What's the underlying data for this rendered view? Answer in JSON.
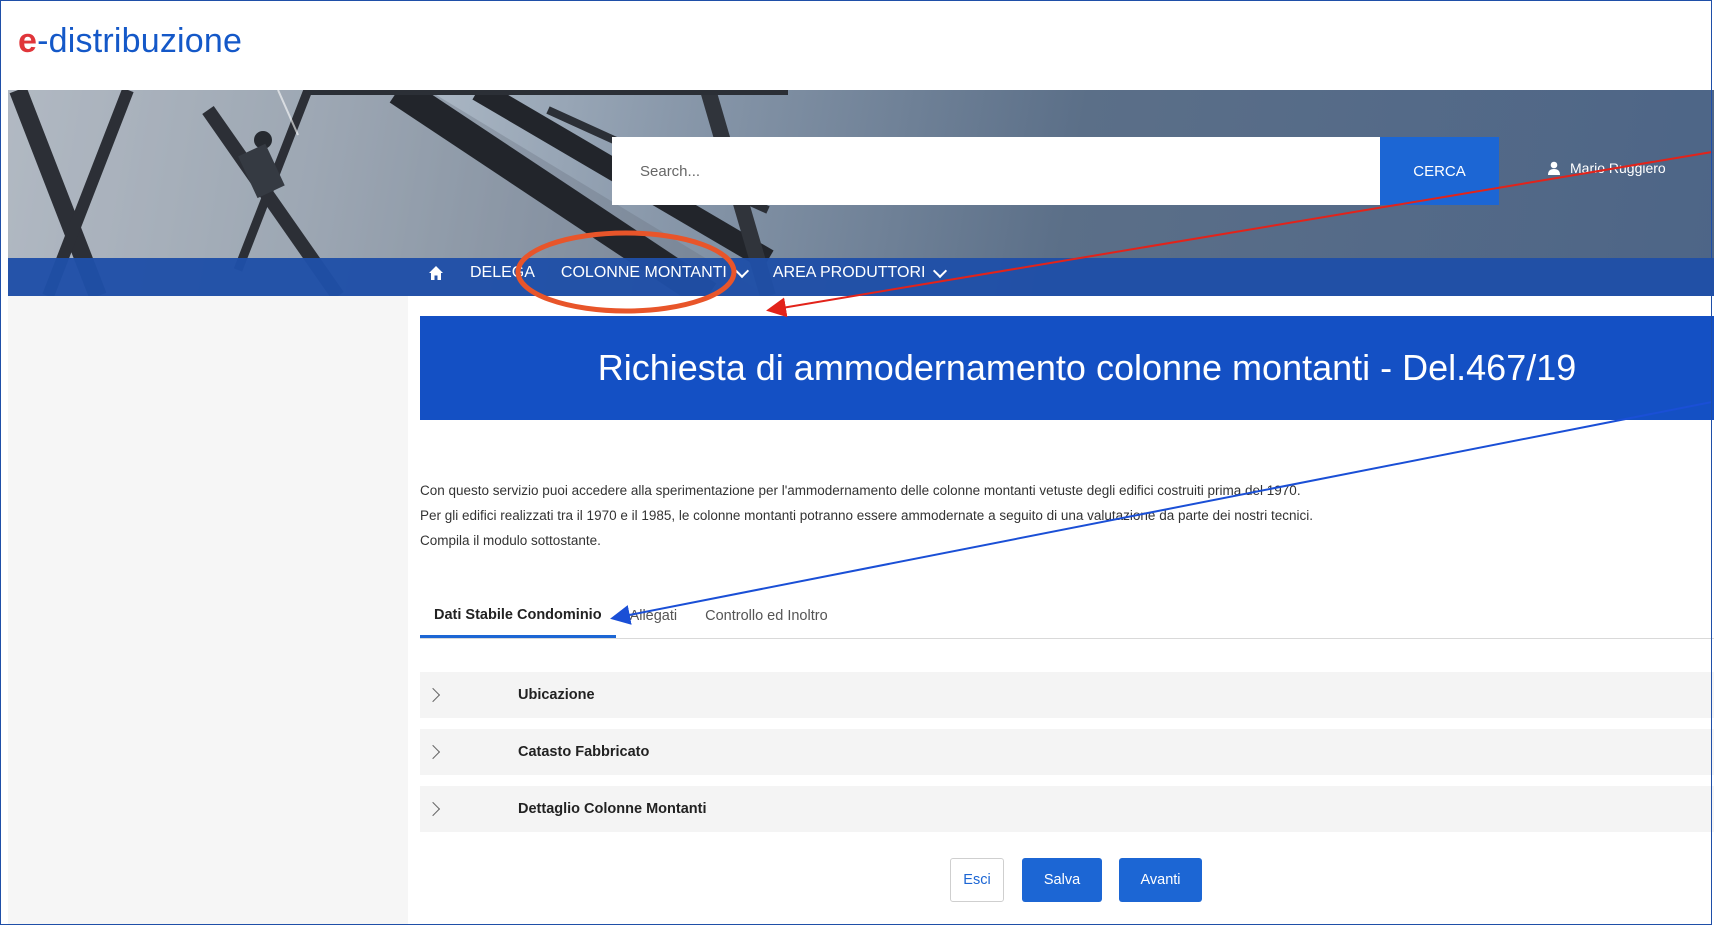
{
  "logo": {
    "prefix": "e",
    "text": "-distribuzione"
  },
  "search": {
    "placeholder": "Search...",
    "button_label": "CERCA"
  },
  "user": {
    "name": "Mario Ruggiero"
  },
  "nav": {
    "items": [
      {
        "label": "DELEGA"
      },
      {
        "label": "COLONNE MONTANTI"
      },
      {
        "label": "AREA PRODUTTORI"
      }
    ]
  },
  "page": {
    "title": "Richiesta di ammodernamento colonne montanti - Del.467/19",
    "description": [
      "Con questo servizio puoi accedere alla sperimentazione per l'ammodernamento delle colonne montanti vetuste degli edifici costruiti prima del 1970.",
      "Per gli edifici realizzati tra il 1970 e il 1985, le colonne montanti potranno essere ammodernate a seguito di una valutazione da parte dei nostri tecnici.",
      "Compila il modulo sottostante."
    ]
  },
  "tabs": [
    {
      "label": "Dati Stabile Condominio",
      "active": true
    },
    {
      "label": "Allegati",
      "active": false
    },
    {
      "label": "Controllo ed Inoltro",
      "active": false
    }
  ],
  "sections": [
    {
      "label": "Ubicazione"
    },
    {
      "label": "Catasto Fabbricato"
    },
    {
      "label": "Dettaglio Colonne Montanti"
    }
  ],
  "buttons": {
    "exit": "Esci",
    "save": "Salva",
    "next": "Avanti"
  },
  "colors": {
    "brand_blue": "#1450c4",
    "accent_blue": "#1c66d4",
    "logo_red": "#e0353a",
    "annotation_red": "#e2231a",
    "annotation_orange": "#e8552a",
    "annotation_blue": "#1a4fd6"
  }
}
